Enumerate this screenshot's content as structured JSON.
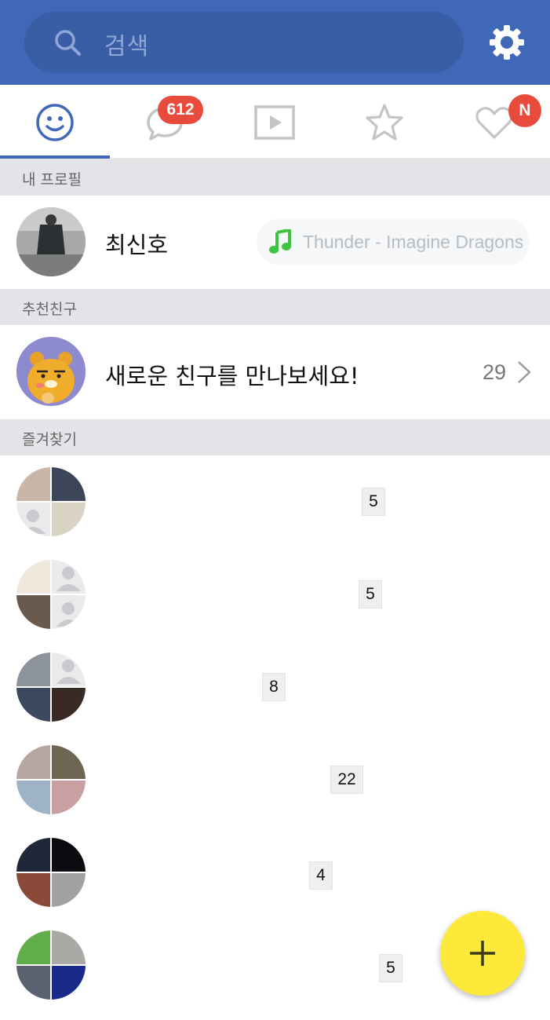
{
  "header": {
    "search_placeholder": "검색",
    "icons": {
      "search": "search-icon",
      "settings": "gear-icon"
    },
    "colors": {
      "bar": "#4068b8",
      "search_field": "#3a5ea6"
    }
  },
  "tabs": [
    {
      "name": "friends",
      "icon": "smiley-icon",
      "active": true
    },
    {
      "name": "chats",
      "icon": "chat-bubble-icon",
      "badge": "612"
    },
    {
      "name": "tv",
      "icon": "play-icon"
    },
    {
      "name": "favorites",
      "icon": "star-icon"
    },
    {
      "name": "more",
      "icon": "heart-icon",
      "badge": "N"
    }
  ],
  "sections": {
    "my_profile": "내 프로필",
    "recommended": "추천친구",
    "favorites": "즐겨찾기"
  },
  "profile": {
    "name": "최신호",
    "music": "Thunder - Imagine Dragons",
    "music_icon": "music-note-icon"
  },
  "recommend": {
    "text": "새로운 친구를 만나보세요!",
    "count": "29",
    "chevron": "chevron-right-icon"
  },
  "favorites": [
    {
      "count": "5"
    },
    {
      "count": "5"
    },
    {
      "count": "8"
    },
    {
      "count": "22"
    },
    {
      "count": "4"
    },
    {
      "count": "5"
    }
  ],
  "fab": {
    "icon": "plus-icon",
    "color": "#fde93a"
  },
  "colors": {
    "accent": "#4068b8",
    "badge": "#e84a3c",
    "music_note": "#3ec43e",
    "section_bg": "#e3e4e8"
  }
}
